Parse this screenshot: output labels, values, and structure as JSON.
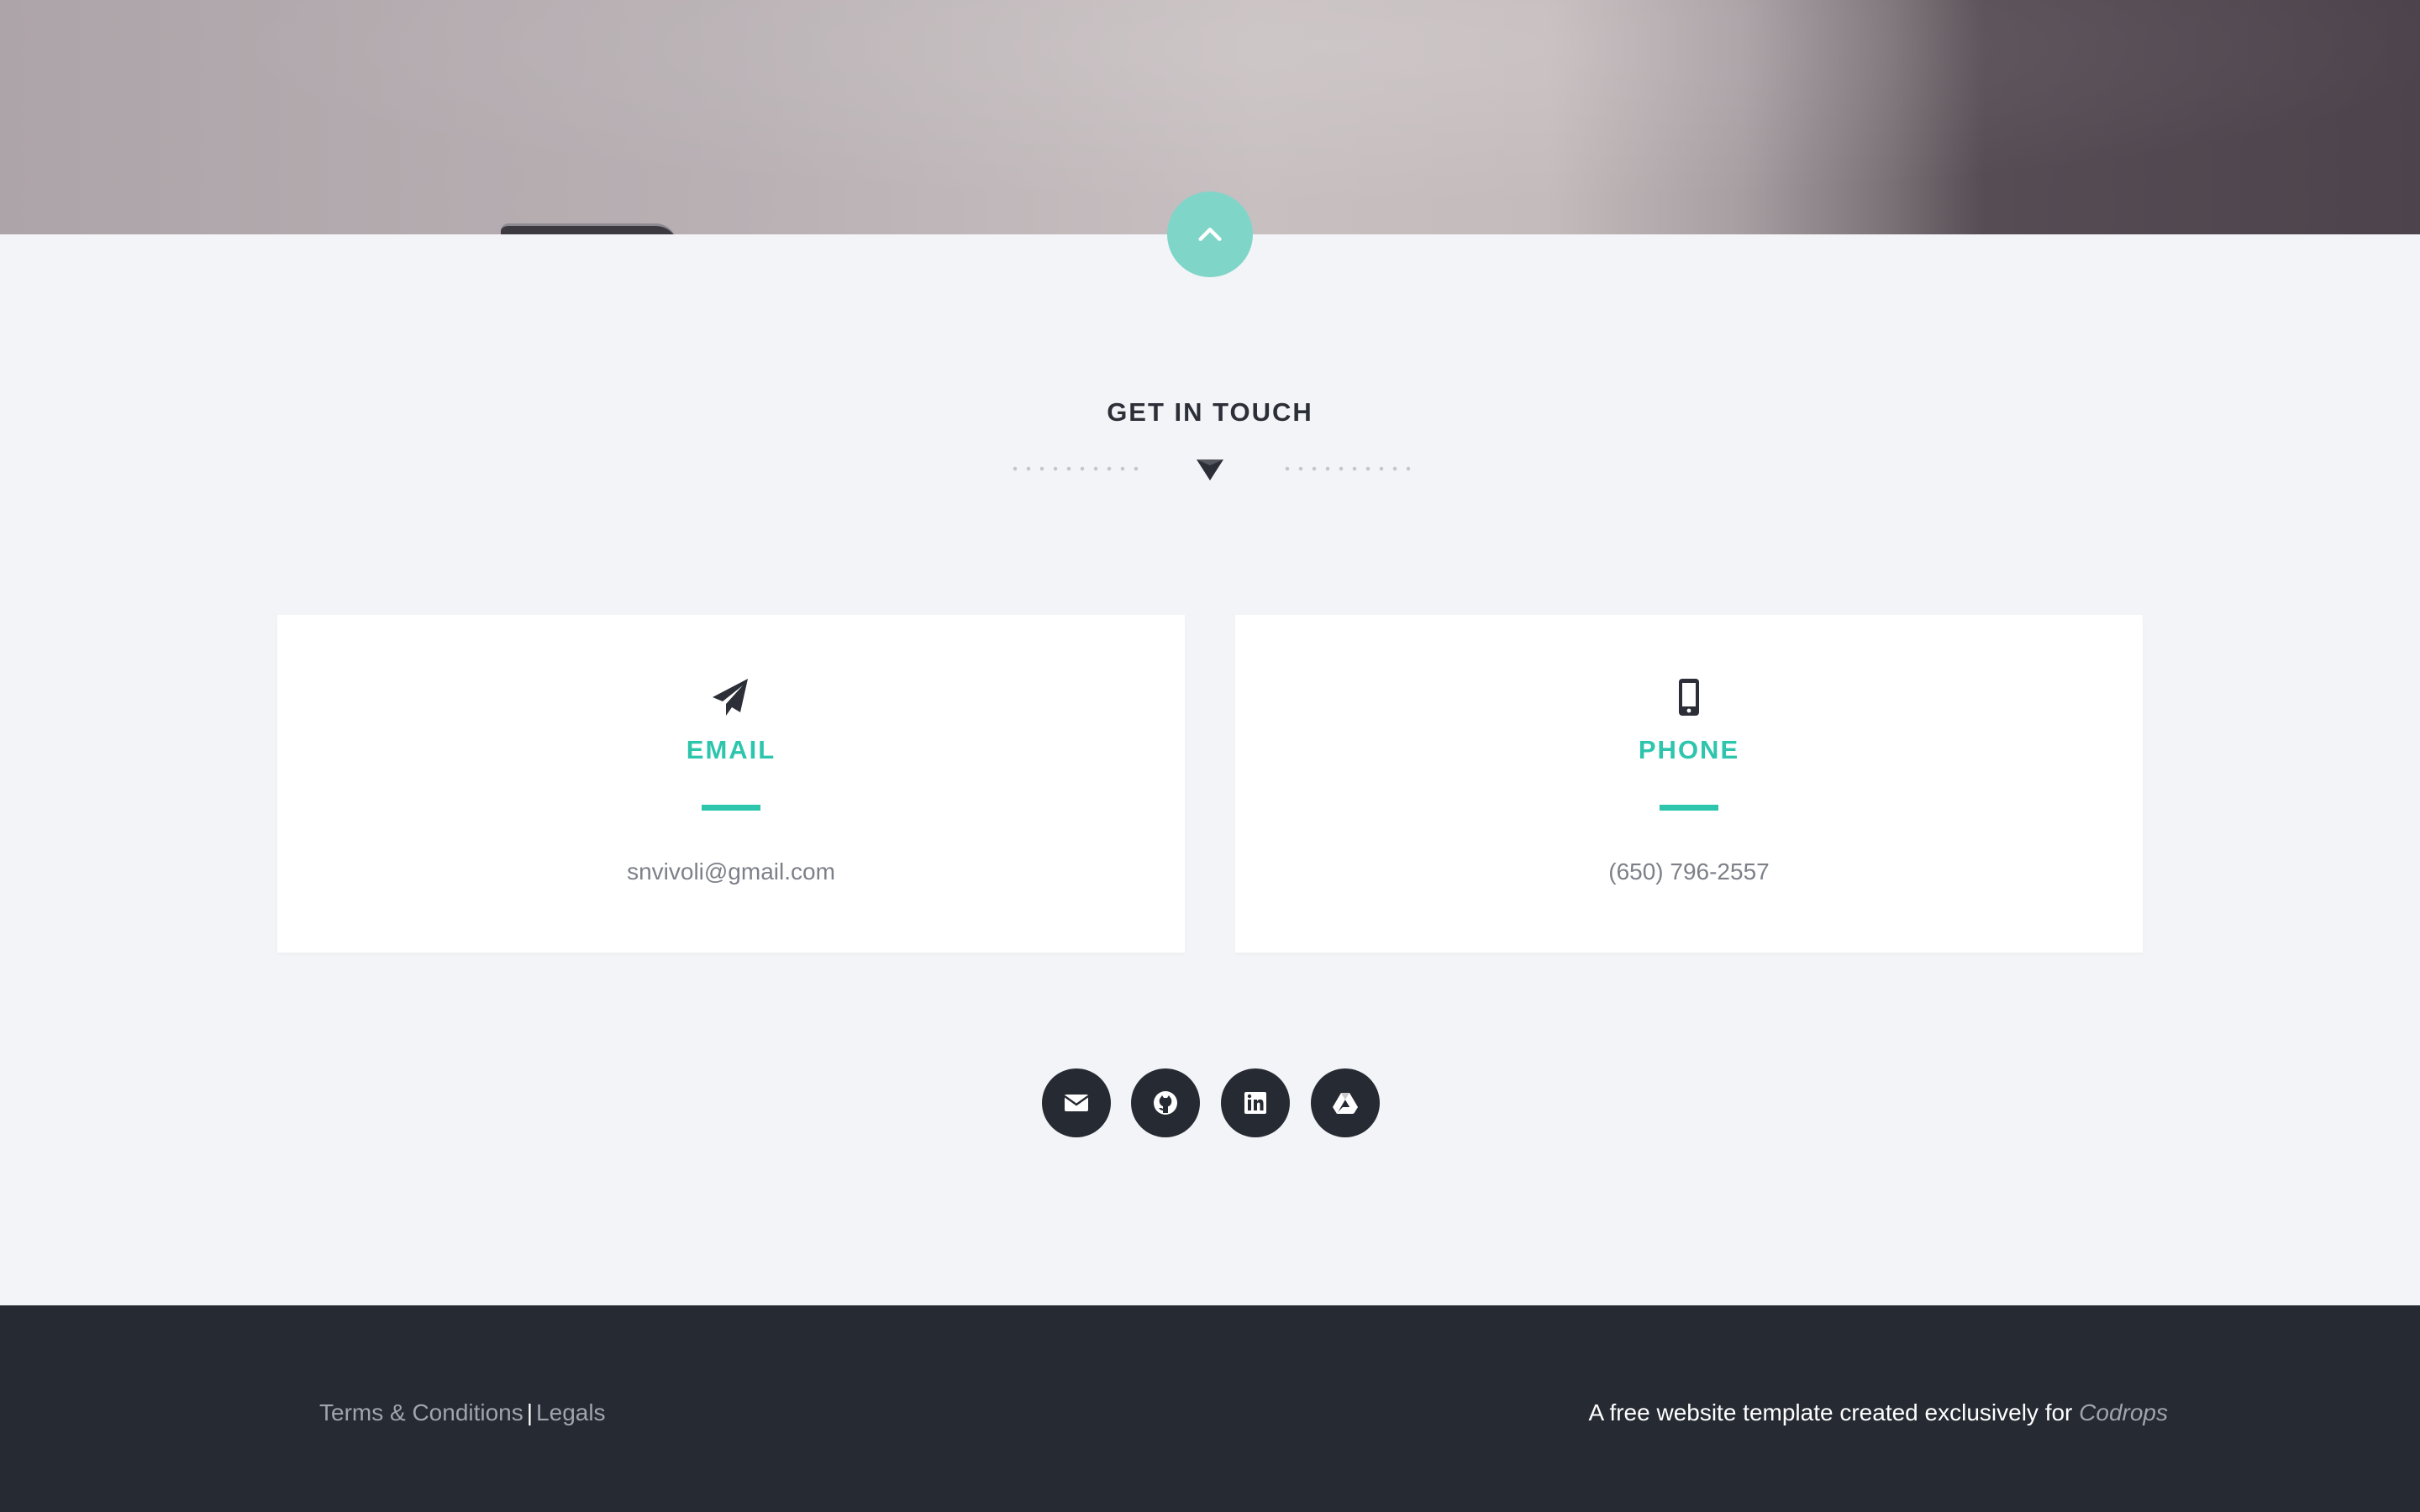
{
  "hero": {
    "back_to_top_icon": "chevron-up-icon",
    "accent": "#7fd6c8"
  },
  "contact": {
    "title": "GET IN TOUCH",
    "divider_icon": "triangle-down-icon",
    "cards": [
      {
        "icon": "paper-plane-icon",
        "title": "EMAIL",
        "value": "snvivoli@gmail.com"
      },
      {
        "icon": "mobile-phone-icon",
        "title": "PHONE",
        "value": "(650) 796-2557"
      }
    ],
    "accent": "#2ec5ad"
  },
  "social": {
    "icons": [
      "envelope-icon",
      "github-icon",
      "linkedin-icon",
      "google-drive-icon"
    ]
  },
  "footer": {
    "terms": "Terms & Conditions",
    "separator": "|",
    "legals": "Legals",
    "credit_text": "A free website template created exclusively for",
    "credit_brand": "Codrops",
    "background": "#262a33"
  }
}
